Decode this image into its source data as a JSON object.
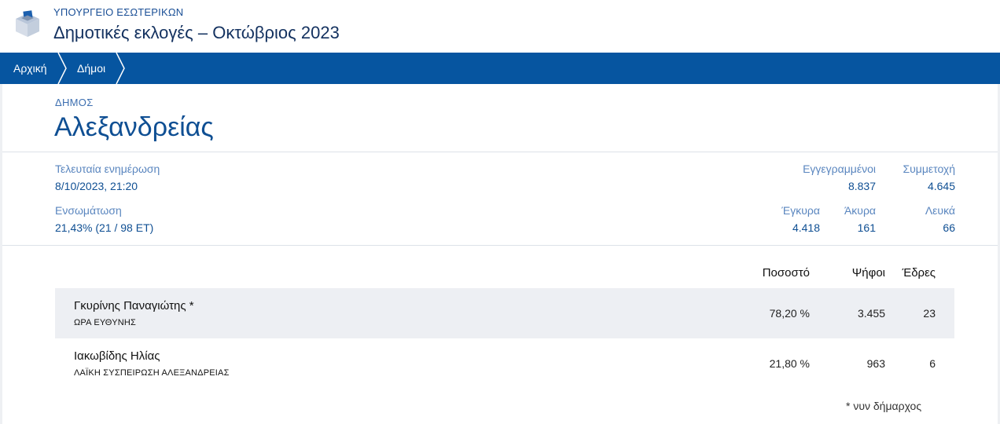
{
  "header": {
    "ministry": "ΥΠΟΥΡΓΕΙΟ ΕΣΩΤΕΡΙΚΩΝ",
    "title": "Δημοτικές εκλογές – Οκτώβριος 2023",
    "logo_icon": "ballot-box-icon"
  },
  "breadcrumb": {
    "items": [
      "Αρχική",
      "Δήμοι"
    ],
    "separator_icon": "chevron-right-icon"
  },
  "municipality": {
    "kicker": "ΔΗΜΟΣ",
    "name": "Αλεξανδρείας"
  },
  "stats": {
    "last_update_label": "Τελευταία ενημέρωση",
    "last_update_value": "8/10/2023, 21:20",
    "integration_label": "Ενσωμάτωση",
    "integration_value": "21,43% (21 / 98 ΕΤ)",
    "registered_label": "Εγγεγραμμένοι",
    "registered_value": "8.837",
    "turnout_label": "Συμμετοχή",
    "turnout_value": "4.645",
    "valid_label": "Έγκυρα",
    "valid_value": "4.418",
    "invalid_label": "Άκυρα",
    "invalid_value": "161",
    "blank_label": "Λευκά",
    "blank_value": "66"
  },
  "results": {
    "columns": [
      "Ποσοστό",
      "Ψήφοι",
      "Έδρες"
    ],
    "rows": [
      {
        "candidate": "Γκυρίνης Παναγιώτης *",
        "party": "ΩΡΑ ΕΥΘΥΝΗΣ",
        "percent": "78,20 %",
        "votes": "3.455",
        "seats": "23"
      },
      {
        "candidate": "Ιακωβίδης Ηλίας",
        "party": "ΛΑΪΚΗ ΣΥΣΠΕΙΡΩΣΗ ΑΛΕΞΑΝΔΡΕΙΑΣ",
        "percent": "21,80 %",
        "votes": "963",
        "seats": "6"
      }
    ],
    "footnote": "* νυν δήμαρχος"
  },
  "colors": {
    "brand_blue": "#0655a0",
    "title_navy": "#13315f",
    "label_blue": "#5a86bf",
    "value_blue": "#0f4f93",
    "row_highlight": "#edeff3"
  }
}
